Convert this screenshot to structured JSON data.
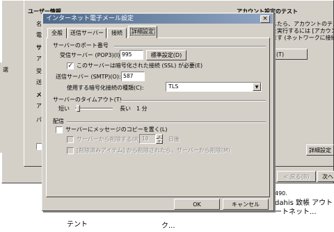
{
  "background_window": {
    "title_partial": "",
    "user_info_heading": "ユーザー情報",
    "account_test_heading": "アカウント設定のテスト",
    "left_labels": [
      "名",
      "電",
      "サ",
      "ア",
      "受",
      "送",
      "メ",
      "ア",
      "パ"
    ],
    "right_desc_lines": [
      "したら、アカウントのテス",
      "を実行するには [アカウン",
      "ます (ネットワークに接続され"
    ],
    "test_button_partial": "(T)",
    "detail_button": "詳細設定",
    "back_button": "< 戻る(B)",
    "next_button": "次へ",
    "left_edge_label": "選"
  },
  "dialog": {
    "title": "インターネット電子メール設定",
    "close_glyph": "×",
    "tabs": [
      {
        "label": "全般"
      },
      {
        "label": "送信サーバー"
      },
      {
        "label": "接続"
      },
      {
        "label": "詳細設定"
      }
    ],
    "server_ports": {
      "group_label": "サーバーのポート番号",
      "incoming_label": "受信サーバー (POP3)(I):",
      "incoming_value": "995",
      "default_button": "標準設定(D)",
      "ssl_checkbox_label": "このサーバーは暗号化された接続 (SSL) が必要(E)",
      "ssl_checked": true,
      "outgoing_label": "送信サーバー (SMTP)(O):",
      "outgoing_value": "587",
      "encryption_label": "使用する暗号化接続の種類(C):",
      "encryption_value": "TLS"
    },
    "timeout": {
      "group_label": "サーバーのタイムアウト(T)",
      "short_label": "短い",
      "long_label": "長い",
      "value": "1 分",
      "slider_fraction": 0.0
    },
    "delivery": {
      "group_label": "配信",
      "copy_checkbox_label": "サーバーにメッセージのコピーを置く(L)",
      "copy_checked": false,
      "remove_after_label": "サーバーから削除する(R)",
      "days_value": "10",
      "days_unit": "日後",
      "remove_deleted_label": "[削除済みアイテム] から削除されたら、サーバーから削除(M)"
    },
    "ok_button": "OK",
    "cancel_button": "キャンセル"
  },
  "behind_text": {
    "number": "490.",
    "app_line": "dahis 致帳 アウトドア",
    "net_line": "ートネット...",
    "bottom_left": "テント",
    "bottom_mid": "ク..."
  }
}
